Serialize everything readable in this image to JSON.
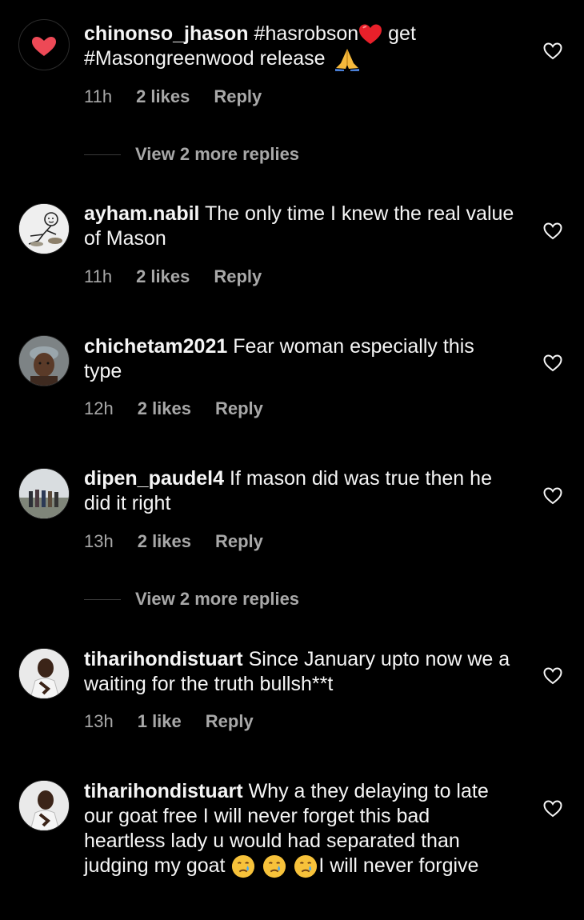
{
  "comments": [
    {
      "username": "chinonso_jhason",
      "text_a": "#hasrobson",
      "text_b": " get",
      "text_c": "#Masongreenwood release ",
      "time": "11h",
      "likes": "2 likes",
      "reply": "Reply",
      "emojis": [
        "red-heart-emoji",
        "folded-hands-emoji"
      ]
    },
    {
      "username": "ayham.nabil",
      "text": "The only time I knew the real value of Mason",
      "time": "11h",
      "likes": "2 likes",
      "reply": "Reply"
    },
    {
      "username": "chichetam2021",
      "text": "Fear woman especially this type",
      "time": "12h",
      "likes": "2 likes",
      "reply": "Reply"
    },
    {
      "username": "dipen_paudel4",
      "text": "If mason did was true then he did it right",
      "time": "13h",
      "likes": "2 likes",
      "reply": "Reply"
    },
    {
      "username": "tiharihondistuart",
      "text": "Since January upto now we a waiting for the truth bullsh**t",
      "time": "13h",
      "likes": "1 like",
      "reply": "Reply"
    },
    {
      "username": "tiharihondistuart",
      "text_a": "Why a they delaying to late our goat free I will never forget this bad heartless lady u would had separated than judging my goat ",
      "text_b": "I will never forgive",
      "emojis": [
        "crying-face-emoji",
        "crying-face-emoji",
        "crying-face-emoji"
      ]
    }
  ],
  "view_replies": [
    {
      "label": "View 2 more replies"
    },
    {
      "label": "View 2 more replies"
    }
  ],
  "colors": {
    "background": "#000000",
    "text": "#f5f5f5",
    "muted": "#a8a8a8",
    "heart": "#ed4956"
  }
}
